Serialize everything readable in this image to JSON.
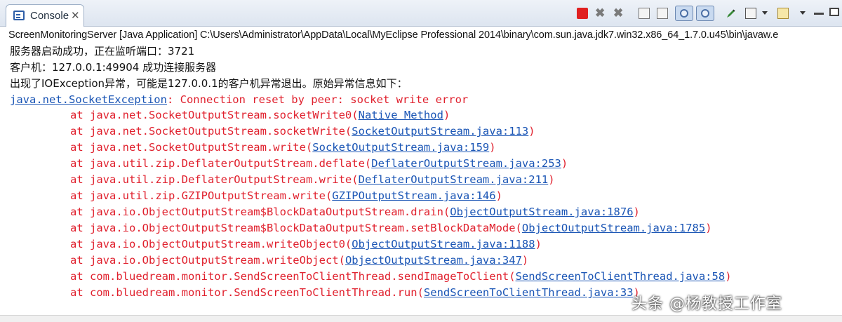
{
  "tab": {
    "label": "Console",
    "close": "✕"
  },
  "toolbar": {
    "icons": [
      "terminate-icon",
      "remove-launch-icon",
      "remove-all-terminated-icon",
      "clear-console-icon",
      "scroll-lock-icon",
      "pin-console-icon",
      "show-console-icon",
      "word-wrap-icon",
      "display-selected-console-icon",
      "open-console-icon",
      "minimize-icon",
      "maximize-icon"
    ],
    "stop_color": "#e02020"
  },
  "console": {
    "launch_path": "ScreenMonitoringServer [Java Application] C:\\Users\\Administrator\\AppData\\Local\\MyEclipse Professional 2014\\binary\\com.sun.java.jdk7.win32.x86_64_1.7.0.u45\\bin\\javaw.e",
    "info_lines": [
      "服务器启动成功，正在监听端口：3721",
      "客户机：127.0.0.1:49904 成功连接服务器",
      "出现了IOException异常，可能是127.0.0.1的客户机异常退出。原始异常信息如下："
    ],
    "exception": {
      "class": "java.net.SocketException",
      "message": ": Connection reset by peer: socket write error"
    },
    "frames": [
      {
        "method": "at java.net.SocketOutputStream.socketWrite0(",
        "link": "Native Method",
        "close": ")"
      },
      {
        "method": "at java.net.SocketOutputStream.socketWrite(",
        "link": "SocketOutputStream.java:113",
        "close": ")"
      },
      {
        "method": "at java.net.SocketOutputStream.write(",
        "link": "SocketOutputStream.java:159",
        "close": ")"
      },
      {
        "method": "at java.util.zip.DeflaterOutputStream.deflate(",
        "link": "DeflaterOutputStream.java:253",
        "close": ")"
      },
      {
        "method": "at java.util.zip.DeflaterOutputStream.write(",
        "link": "DeflaterOutputStream.java:211",
        "close": ")"
      },
      {
        "method": "at java.util.zip.GZIPOutputStream.write(",
        "link": "GZIPOutputStream.java:146",
        "close": ")"
      },
      {
        "method": "at java.io.ObjectOutputStream$BlockDataOutputStream.drain(",
        "link": "ObjectOutputStream.java:1876",
        "close": ")"
      },
      {
        "method": "at java.io.ObjectOutputStream$BlockDataOutputStream.setBlockDataMode(",
        "link": "ObjectOutputStream.java:1785",
        "close": ")"
      },
      {
        "method": "at java.io.ObjectOutputStream.writeObject0(",
        "link": "ObjectOutputStream.java:1188",
        "close": ")"
      },
      {
        "method": "at java.io.ObjectOutputStream.writeObject(",
        "link": "ObjectOutputStream.java:347",
        "close": ")"
      },
      {
        "method": "at com.bluedream.monitor.SendScreenToClientThread.sendImageToClient(",
        "link": "SendScreenToClientThread.java:58",
        "close": ")"
      },
      {
        "method": "at com.bluedream.monitor.SendScreenToClientThread.run(",
        "link": "SendScreenToClientThread.java:33",
        "close": ")"
      }
    ],
    "error_color": "#e0202d",
    "link_color": "#1a55b5"
  },
  "watermark": "头条 @杨教授工作室"
}
